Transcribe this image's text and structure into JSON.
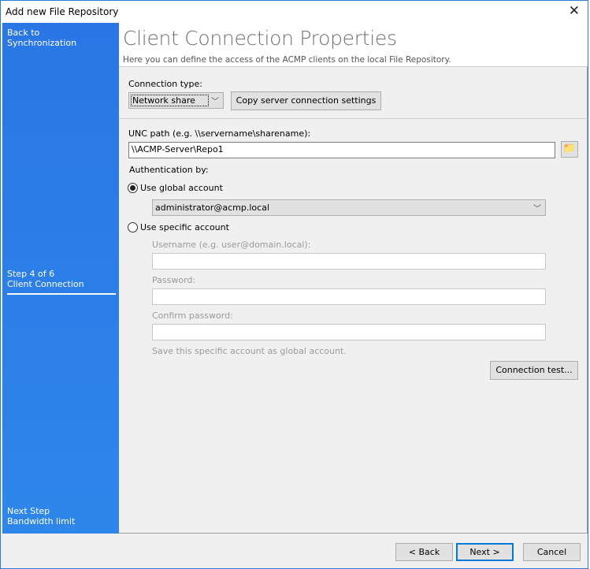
{
  "window": {
    "title": "Add new File Repository"
  },
  "sidebar": {
    "back": "Back to Synchronization",
    "step": "Step 4 of 6",
    "current": "Client Connection",
    "next_label": "Next Step",
    "next": "Bandwidth limit"
  },
  "header": {
    "title": "Client Connection Properties",
    "subtitle": "Here you can define the access of the ACMP clients on the local File Repository."
  },
  "form": {
    "connection_type_label": "Connection type:",
    "connection_type": "Network share",
    "copy_button": "Copy server connection settings",
    "unc_label": "UNC path (e.g. \\\\servername\\sharename):",
    "unc_value": "\\\\ACMP-Server\\Repo1",
    "auth_label": "Authentication by:",
    "global_label": "Use global account",
    "global_account": "administrator@acmp.local",
    "specific_label": "Use specific account",
    "username_label": "Username (e.g. user@domain.local):",
    "password_label": "Password:",
    "confirm_label": "Confirm password:",
    "save_global": "Save this specific account as global account.",
    "test_button": "Connection test..."
  },
  "footer": {
    "back": "< Back",
    "next": "Next >",
    "cancel": "Cancel"
  },
  "colors": {
    "sidebar": "#2a76e6",
    "accent": "#0078d7"
  }
}
